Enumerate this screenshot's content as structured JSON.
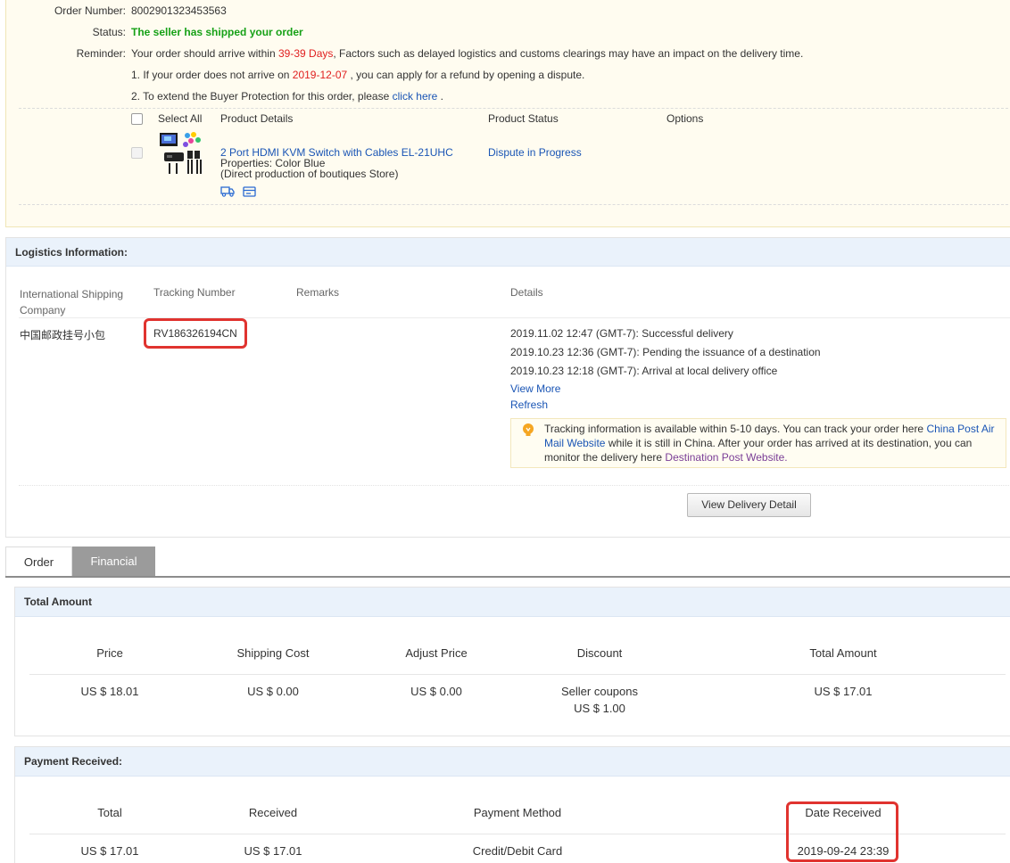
{
  "order": {
    "order_number_label": "Order Number:",
    "order_number": "8002901323453563",
    "status_label": "Status:",
    "status": "The seller has shipped your order",
    "reminder_label": "Reminder:",
    "reminder_pre": "Your order should arrive within",
    "reminder_days": "39-39 Days",
    "reminder_post": ", Factors such as delayed logistics and customs clearings may have an impact on the delivery time.",
    "note1_pre": "1. If your order does not arrive on",
    "note1_date": "2019-12-07",
    "note1_post": ", you can apply for a refund by opening a dispute.",
    "note2_pre": "2. To extend the Buyer Protection for this order, please",
    "note2_link": "click here",
    "note2_post": "."
  },
  "product_table": {
    "select_all": "Select All",
    "col_details": "Product Details",
    "col_status": "Product Status",
    "col_options": "Options",
    "product_name": "2 Port HDMI KVM Switch with Cables EL-21UHC",
    "properties": "Properties: Color Blue",
    "store": "(Direct production of boutiques Store)",
    "status": "Dispute in Progress",
    "icons": [
      "truck-icon",
      "card-icon"
    ]
  },
  "logistics": {
    "title": "Logistics Information:",
    "col_company": "International Shipping Company",
    "col_company_line1": "International Shipping",
    "col_company_line2": "Company",
    "col_tracking": "Tracking Number",
    "col_remarks": "Remarks",
    "col_details": "Details",
    "company": "中国邮政挂号小包",
    "tracking_number": "RV186326194CN",
    "events": [
      "2019.11.02 12:47 (GMT-7): Successful delivery",
      "2019.10.23 12:36 (GMT-7): Pending the issuance of a destination",
      "2019.10.23 12:18 (GMT-7): Arrival at local delivery office"
    ],
    "view_more": "View More",
    "refresh": "Refresh",
    "tip_1": "Tracking information is available within 5-10 days. You can track your order here",
    "tip_link1": "China Post Air Mail Website",
    "tip_link1_a": "China Post Air",
    "tip_link1_b": "Mail Website",
    "tip_2": "while it is still in China. After your order has arrived at its destination, you can",
    "tip_3": "monitor the delivery here",
    "tip_link2": "Destination Post Website.",
    "view_delivery_button": "View Delivery Detail",
    "highlight_color": "#e0332f"
  },
  "tabs": [
    {
      "label": "Order",
      "active": false
    },
    {
      "label": "Financial",
      "active": true
    }
  ],
  "total_amount": {
    "title": "Total Amount",
    "headers": [
      "Price",
      "Shipping Cost",
      "Adjust Price",
      "Discount",
      "Total Amount"
    ],
    "values": [
      "US $ 18.01",
      "US $ 0.00",
      "US $ 0.00",
      "Seller coupons",
      "US $ 17.01"
    ],
    "discount_amount": "US $ 1.00"
  },
  "payment_received": {
    "title": "Payment Received:",
    "headers": [
      "Total",
      "Received",
      "Payment Method",
      "Date Received"
    ],
    "values": [
      "US $ 17.01",
      "US $ 17.01",
      "Credit/Debit Card",
      "2019-09-24 23:39"
    ]
  }
}
